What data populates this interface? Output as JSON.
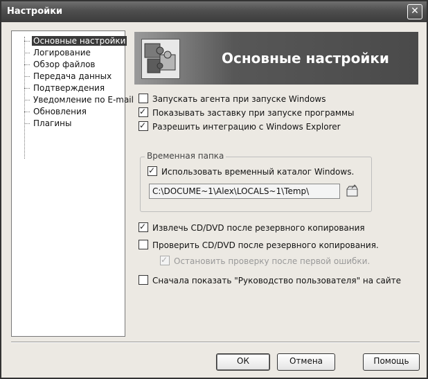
{
  "window": {
    "title": "Настройки",
    "close_glyph": "✕"
  },
  "sidebar": {
    "items": [
      {
        "label": "Основные настройки",
        "selected": true
      },
      {
        "label": "Логирование"
      },
      {
        "label": "Обзор файлов"
      },
      {
        "label": "Передача данных"
      },
      {
        "label": "Подтверждения"
      },
      {
        "label": "Уведомление по E-mail"
      },
      {
        "label": "Обновления"
      },
      {
        "label": "Плагины"
      }
    ]
  },
  "header": {
    "title": "Основные настройки",
    "icon": "puzzle-icon"
  },
  "options": {
    "start_agent": {
      "label": "Запускать агента при запуске Windows",
      "checked": false
    },
    "show_splash": {
      "label": "Показывать заставку при запуске программы",
      "checked": true
    },
    "explorer_integration": {
      "label": "Разрешить интеграцию с Windows Explorer",
      "checked": true
    },
    "eject_cd": {
      "label": "Извлечь CD/DVD после резервного копирования",
      "checked": true
    },
    "verify_cd": {
      "label": "Проверить CD/DVD после резервного копирования.",
      "checked": false
    },
    "stop_on_error": {
      "label": "Остановить проверку после первой ошибки.",
      "checked": true,
      "disabled": true
    },
    "show_guide": {
      "label": "Сначала показать \"Руководство пользователя\" на сайте",
      "checked": false
    }
  },
  "temp_folder": {
    "group_title": "Временная папка",
    "use_windows_temp": {
      "label": "Использовать временный каталог Windows.",
      "checked": true
    },
    "path": "C:\\DOCUME~1\\Alex\\LOCALS~1\\Temp\\",
    "browse_icon": "folder-browse-icon"
  },
  "buttons": {
    "ok": "ОК",
    "cancel": "Отмена",
    "help": "Помощь"
  },
  "colors": {
    "titlebar": "#4e4e4e",
    "header_bg": "#4a4a4a",
    "selection": "#3a3a3a"
  }
}
